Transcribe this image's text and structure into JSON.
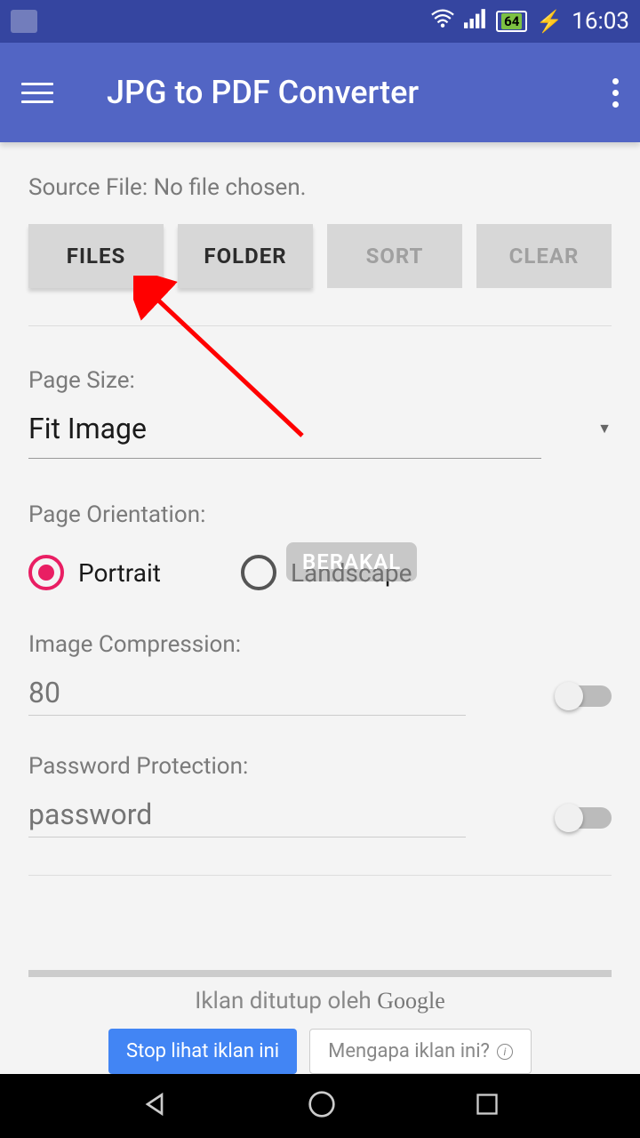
{
  "status_bar": {
    "battery_level": "64",
    "time": "16:03"
  },
  "app_bar": {
    "title": "JPG to PDF Converter"
  },
  "source_file": {
    "label": "Source File: No file chosen."
  },
  "buttons": {
    "files": "FILES",
    "folder": "FOLDER",
    "sort": "SORT",
    "clear": "CLEAR"
  },
  "page_size": {
    "label": "Page Size:",
    "value": "Fit Image"
  },
  "page_orientation": {
    "label": "Page Orientation:",
    "portrait": "Portrait",
    "landscape": "Landscape"
  },
  "watermark": "BERAKAL",
  "image_compression": {
    "label": "Image Compression:",
    "placeholder": "80"
  },
  "password_protection": {
    "label": "Password Protection:",
    "placeholder": "password"
  },
  "ads": {
    "closed_by": "Iklan ditutup oleh ",
    "google": "Google",
    "stop_button": "Stop lihat iklan ini",
    "why_button": "Mengapa iklan ini?"
  }
}
